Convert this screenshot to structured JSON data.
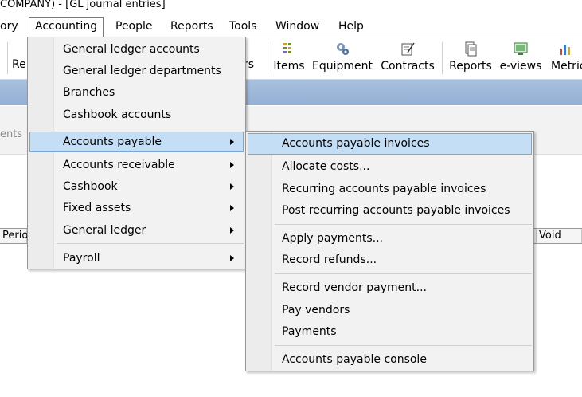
{
  "window": {
    "title": "COMPANY) - [GL journal entries]"
  },
  "menubar": {
    "items": [
      {
        "label": "ory"
      },
      {
        "label": "Accounting"
      },
      {
        "label": "People"
      },
      {
        "label": "Reports"
      },
      {
        "label": "Tools"
      },
      {
        "label": "Window"
      },
      {
        "label": "Help"
      }
    ]
  },
  "toolbar": {
    "left_partial": "Re",
    "mid_partial": "rs",
    "buttons": [
      {
        "label": "Items",
        "icon": "items-icon"
      },
      {
        "label": "Equipment",
        "icon": "equipment-icon"
      },
      {
        "label": "Contracts",
        "icon": "contracts-icon"
      },
      {
        "label": "Reports",
        "icon": "reports-icon"
      },
      {
        "label": "e-views",
        "icon": "eviews-icon"
      },
      {
        "label": "Metric",
        "icon": "metrics-icon"
      }
    ]
  },
  "tabstrip": {
    "label": "ents"
  },
  "grid": {
    "headers": [
      "Perio",
      "Void"
    ]
  },
  "accounting_menu": {
    "items": [
      {
        "label": "General ledger accounts"
      },
      {
        "label": "General ledger departments"
      },
      {
        "label": "Branches"
      },
      {
        "label": "Cashbook accounts"
      },
      {
        "label": "Accounts payable"
      },
      {
        "label": "Accounts receivable"
      },
      {
        "label": "Cashbook"
      },
      {
        "label": "Fixed assets"
      },
      {
        "label": "General ledger"
      },
      {
        "label": "Payroll"
      }
    ]
  },
  "payable_submenu": {
    "items": [
      {
        "label": "Accounts payable invoices"
      },
      {
        "label": "Allocate costs..."
      },
      {
        "label": "Recurring accounts payable invoices"
      },
      {
        "label": "Post recurring accounts payable invoices"
      },
      {
        "label": "Apply payments..."
      },
      {
        "label": "Record refunds..."
      },
      {
        "label": "Record vendor payment..."
      },
      {
        "label": "Pay vendors"
      },
      {
        "label": "Payments"
      },
      {
        "label": "Accounts payable console"
      }
    ]
  },
  "colors": {
    "highlight": "#c3def5",
    "highlight_border": "#7aa7d6",
    "band": "#a9c1df"
  }
}
